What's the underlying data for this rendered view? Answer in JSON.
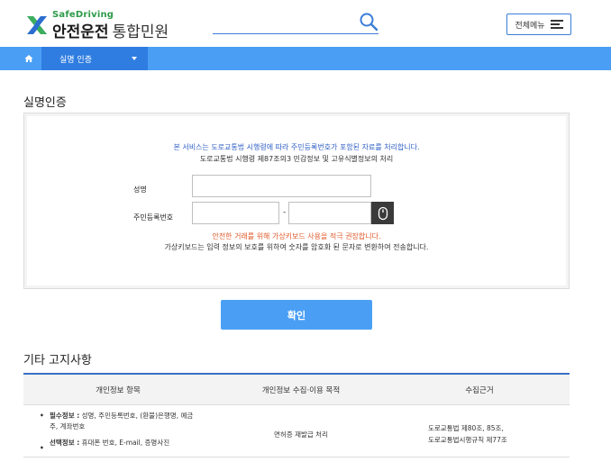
{
  "header": {
    "brand_sub": "SafeDriving",
    "brand_main": "안전운전",
    "brand_service": "통합민원",
    "menu_label": "전체메뉴",
    "colors": {
      "accent": "#3b7dd8",
      "brand_green": "#2d9b4a",
      "brand_blue": "#2b6ed0"
    }
  },
  "nav": {
    "crumb_label": "실명 인증",
    "colors": {
      "bar": "#4a9ff5",
      "active": "#2f7de1"
    }
  },
  "page": {
    "title": "실명인증"
  },
  "form": {
    "notice_line1": "본 서비스는 도로교통법 시행령에 따라 주민등록번호가 포함된 자료를 처리합니다.",
    "notice_line2": "도로교통법 시행령 제87조의3 민감정보 및 고유식별정보의 처리",
    "name_label": "성명",
    "rrn_label": "주민등록번호",
    "name_value": "",
    "rrn_front_value": "",
    "rrn_back_value": "",
    "dash": "-",
    "warning": "안전한 거래를 위해 가상키보드 사용을 적극 권장합니다.",
    "info": "가상키보드는 입력 정보의 보호를 위하여 숫자를 암호화 된 문자로 변환하여 전송합니다."
  },
  "confirm_label": "확인",
  "notice": {
    "title": "기타 고지사항",
    "columns": [
      "개인정보 항목",
      "개인정보 수집·이용 목적",
      "수집근거"
    ],
    "row": {
      "required_label": "필수정보 :",
      "required_line1": " 성명, 주민등록번호, (환불)은행명, 예금",
      "required_line2": "주, 계좌번호",
      "optional_label": "선택정보 :",
      "optional_text": " 휴대폰 번호, E-mail, 증명사진",
      "purpose": "면허증 재발급 처리",
      "basis_line1": "도로교통법 제80조, 85조,",
      "basis_line2": "도로교통법시행규칙 제77조"
    }
  }
}
